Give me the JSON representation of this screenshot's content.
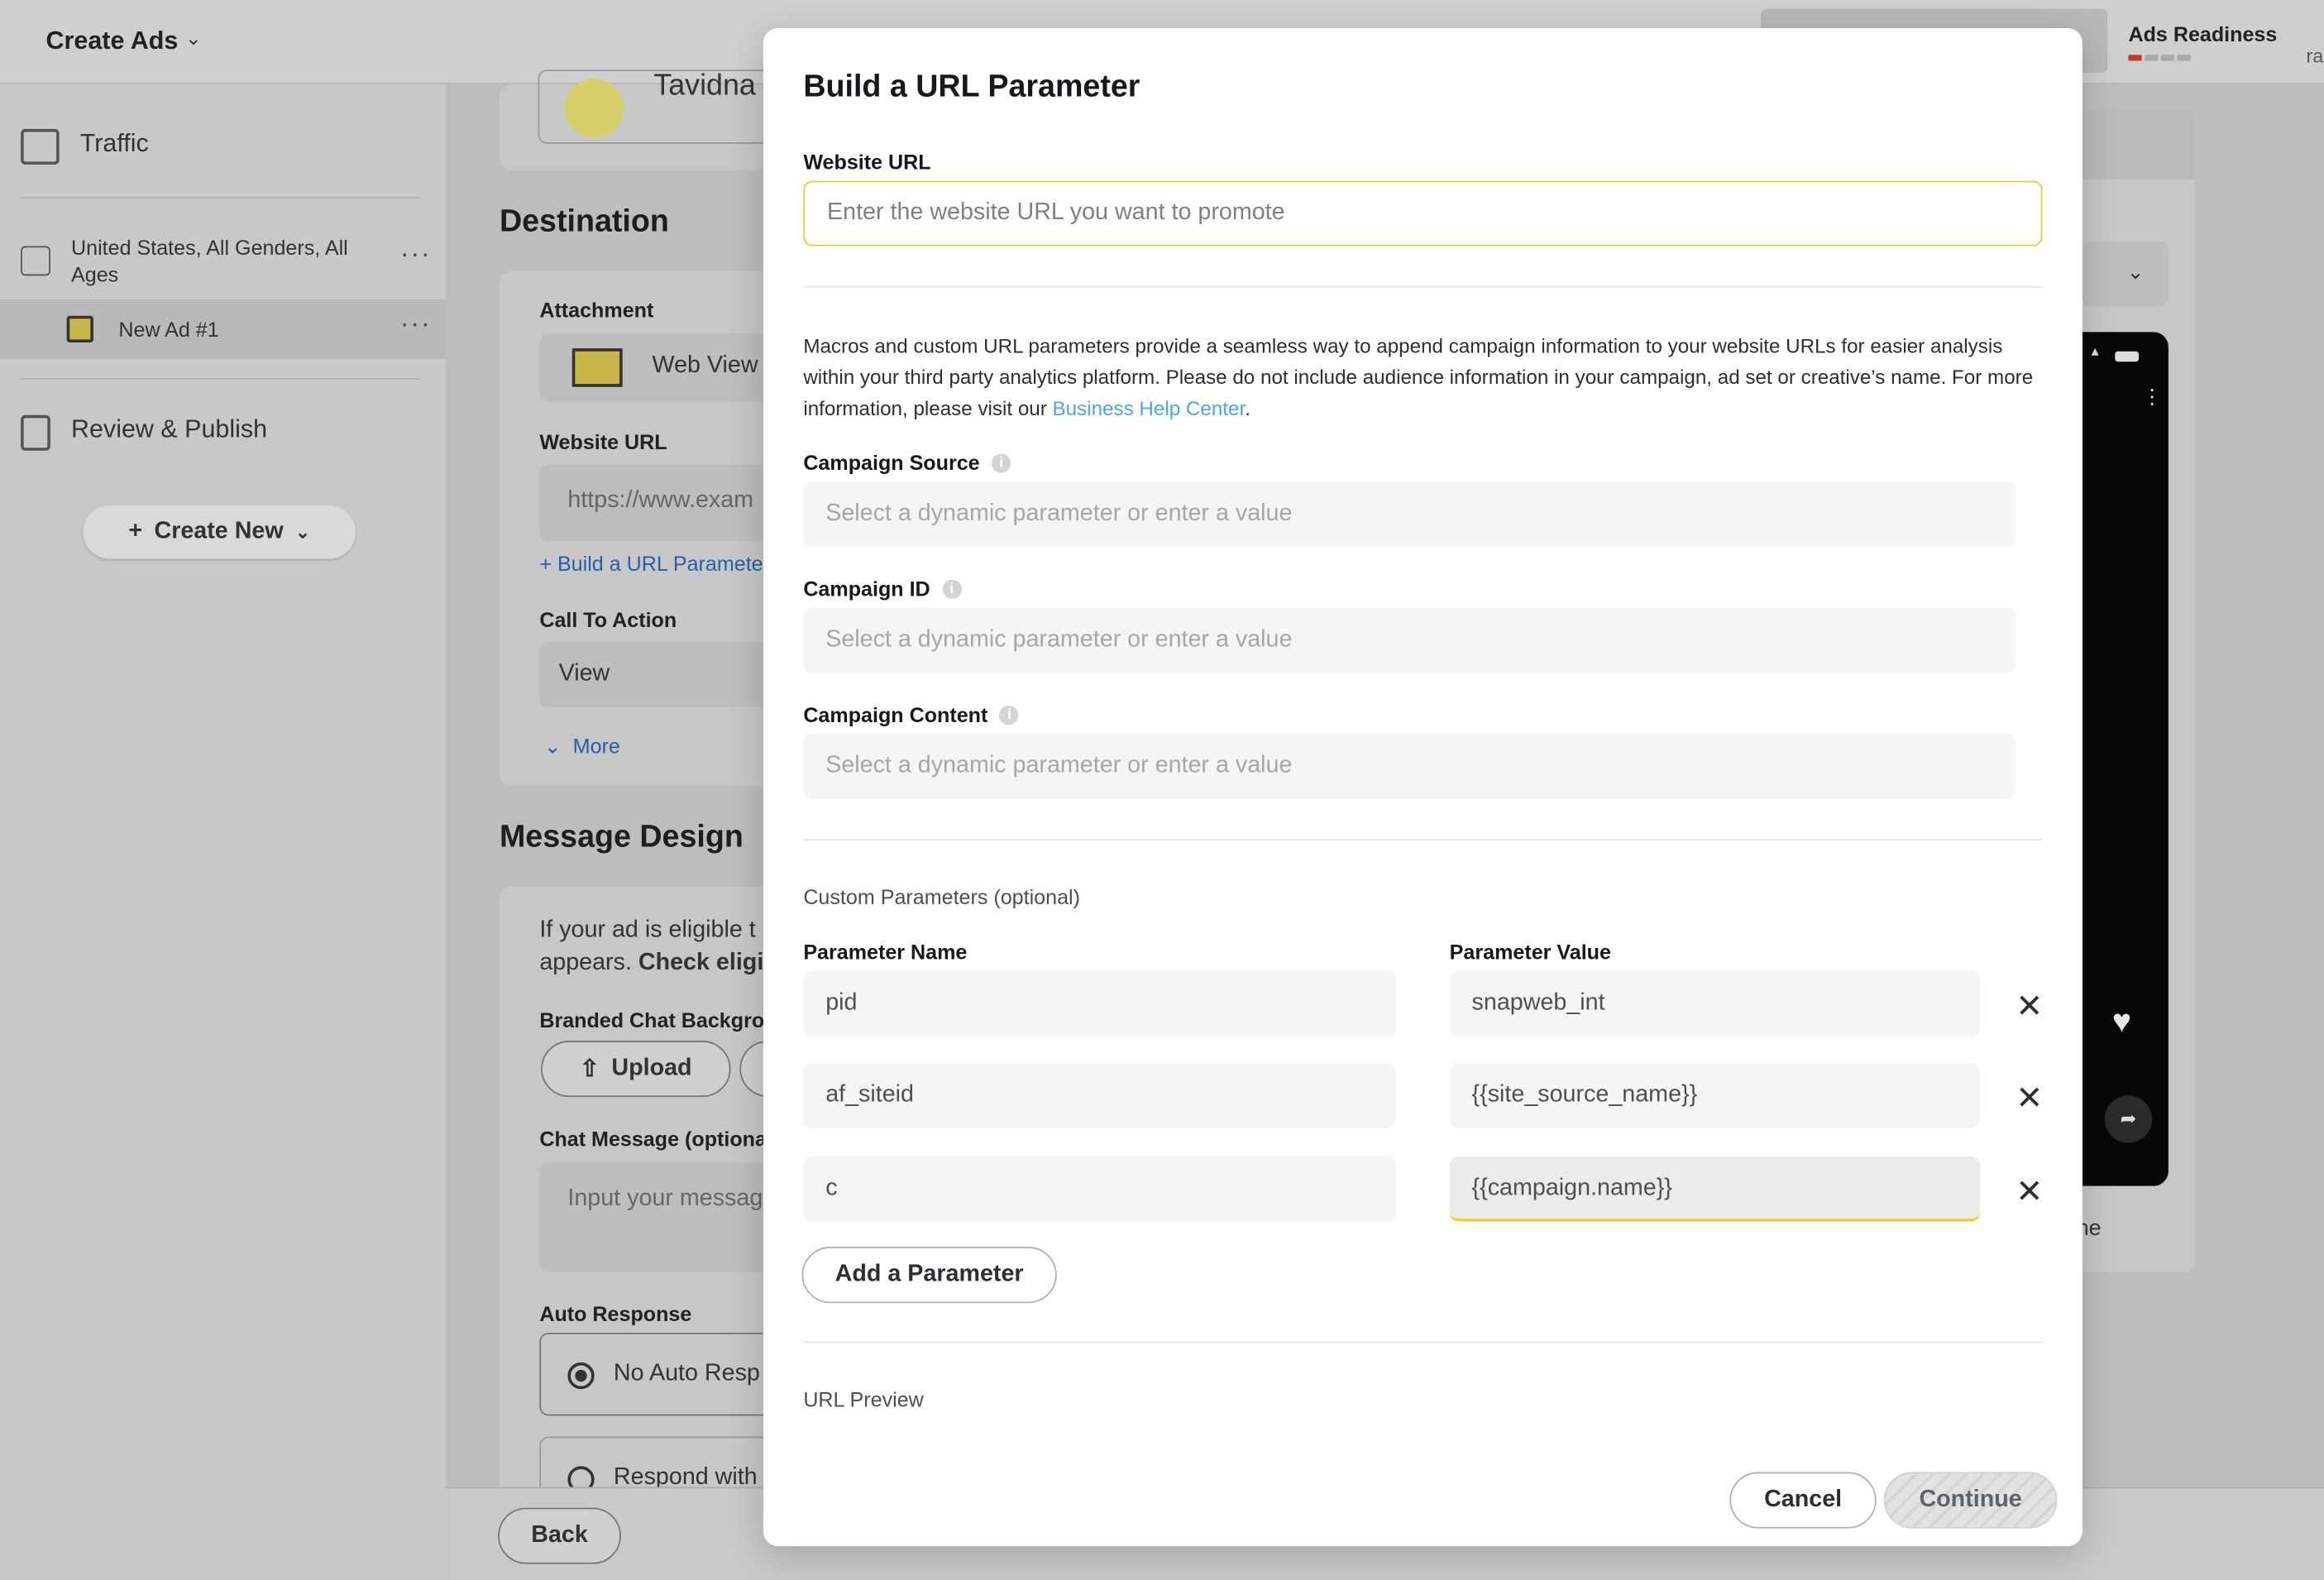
{
  "app": {
    "title": "Create Ads",
    "ads_readiness": "Ads Readiness",
    "edge_text": "ra"
  },
  "sidebar": {
    "traffic": "Traffic",
    "ad_set": "United States, All Genders, All Ages",
    "ad": "New Ad #1",
    "review": "Review & Publish",
    "create_new": "Create New"
  },
  "background": {
    "profile_name_partial": "Tavidna",
    "destination_heading": "Destination",
    "attachment_label": "Attachment",
    "attachment_value": "Web View",
    "website_url_label": "Website URL",
    "website_url_placeholder": "https://www.exam",
    "build_url_link": "+ Build a URL Parameter",
    "cta_label": "Call To Action",
    "cta_value": "View",
    "more_link": "More",
    "message_design_heading": "Message Design",
    "message_text_1": "If your ad is eligible t",
    "message_text_2_a": "appears. ",
    "message_text_2_b": "Check eligi",
    "chat_bg_label": "Branded Chat Backgrou",
    "upload_button": "Upload",
    "chat_message_label": "Chat Message (optional",
    "chat_message_placeholder": "Input your messag",
    "auto_response_label": "Auto Response",
    "auto_response_option_1": "No Auto Resp",
    "auto_response_option_2": "Respond with",
    "right_partial_text": "ne",
    "back_button": "Back"
  },
  "modal": {
    "title": "Build a URL Parameter",
    "website_url_label": "Website URL",
    "website_url_placeholder": "Enter the website URL you want to promote",
    "description_pre": "Macros and custom URL parameters provide a seamless way to append campaign information to your website URLs for easier analysis within your third party analytics platform. Please do not include audience information in your campaign, ad set or creative’s name. For more information, please visit our ",
    "description_link": "Business Help Center",
    "description_post": ".",
    "campaign_source_label": "Campaign Source",
    "campaign_id_label": "Campaign ID",
    "campaign_content_label": "Campaign Content",
    "select_placeholder": "Select a dynamic parameter or enter a value",
    "custom_params_heading": "Custom Parameters (optional)",
    "param_name_header": "Parameter Name",
    "param_value_header": "Parameter Value",
    "params": [
      {
        "name": "pid",
        "value": "snapweb_int"
      },
      {
        "name": "af_siteid",
        "value": "{{site_source_name}}"
      },
      {
        "name": "c",
        "value": "{{campaign.name}}"
      }
    ],
    "add_param_button": "Add a Parameter",
    "url_preview_label": "URL Preview",
    "cancel_button": "Cancel",
    "continue_button": "Continue"
  },
  "colors": {
    "accent_yellow": "#f0cd32",
    "link_blue": "#4ea8e0"
  }
}
